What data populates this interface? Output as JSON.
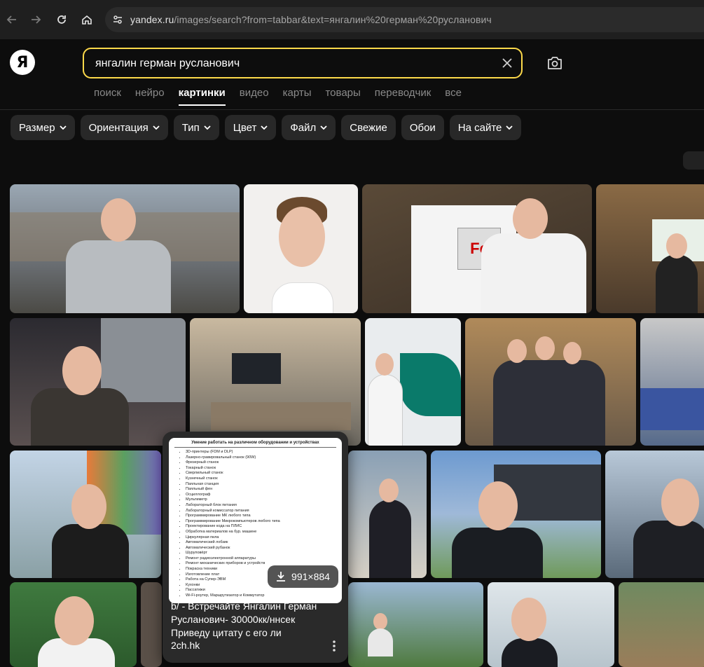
{
  "browser": {
    "url_host": "yandex.ru",
    "url_rest": "/images/search?from=tabbar&text=янгалин%20герман%20русланович"
  },
  "logo": "Я",
  "search": {
    "value": "янгалин герман русланович"
  },
  "tabs": [
    {
      "label": "поиск",
      "active": false
    },
    {
      "label": "нейро",
      "active": false
    },
    {
      "label": "картинки",
      "active": true
    },
    {
      "label": "видео",
      "active": false
    },
    {
      "label": "карты",
      "active": false
    },
    {
      "label": "товары",
      "active": false
    },
    {
      "label": "переводчик",
      "active": false
    },
    {
      "label": "все",
      "active": false
    }
  ],
  "filters": [
    {
      "label": "Размер",
      "dropdown": true
    },
    {
      "label": "Ориентация",
      "dropdown": true
    },
    {
      "label": "Тип",
      "dropdown": true
    },
    {
      "label": "Цвет",
      "dropdown": true
    },
    {
      "label": "Файл",
      "dropdown": true
    },
    {
      "label": "Свежие",
      "dropdown": false
    },
    {
      "label": "Обои",
      "dropdown": false
    },
    {
      "label": "На сайте",
      "dropdown": true
    }
  ],
  "popup": {
    "doc_title": "Умение работать на различном оборудовании и устройствах",
    "doc_items": [
      "3D-принтеры (FDM и DLP)",
      "Лазерно-гравировальный станок (90W)",
      "Фрезерный станок",
      "Токарный станок",
      "Сверлильный станок",
      "Кузнечный станок",
      "Паяльная станция",
      "Паяльный фен",
      "Осциллограф",
      "Мультиметр",
      "Лабораторный блок питания",
      "Лабораторный комиссатор питания",
      "Программирование МК любого типа",
      "Программирование Микрокомпьютеров любого типа",
      "Проектирование кода на ПЛИС",
      "Обработка материалов на бур. машине",
      "Циркулярная пила",
      "Автоматический лобзик",
      "Автоматический рубанок",
      "Шуруповёрт",
      "Ремонт радиоэлектронной аппаратуры",
      "Ремонт механических приборов и устройств",
      "Покраска техники",
      "Изготовление плат",
      "Работа на Супер-ЭВМ",
      "Кухонки",
      "Пассатижи",
      "Wi-Fi-роутер, Маршрутизатор и Коммутатор"
    ],
    "size": "991×884",
    "caption": "b/ - Встречайте Янгалин Герман Русланович- 30000кк/ннсек Приведу цитату с его ли",
    "domain": "2ch.hk"
  }
}
